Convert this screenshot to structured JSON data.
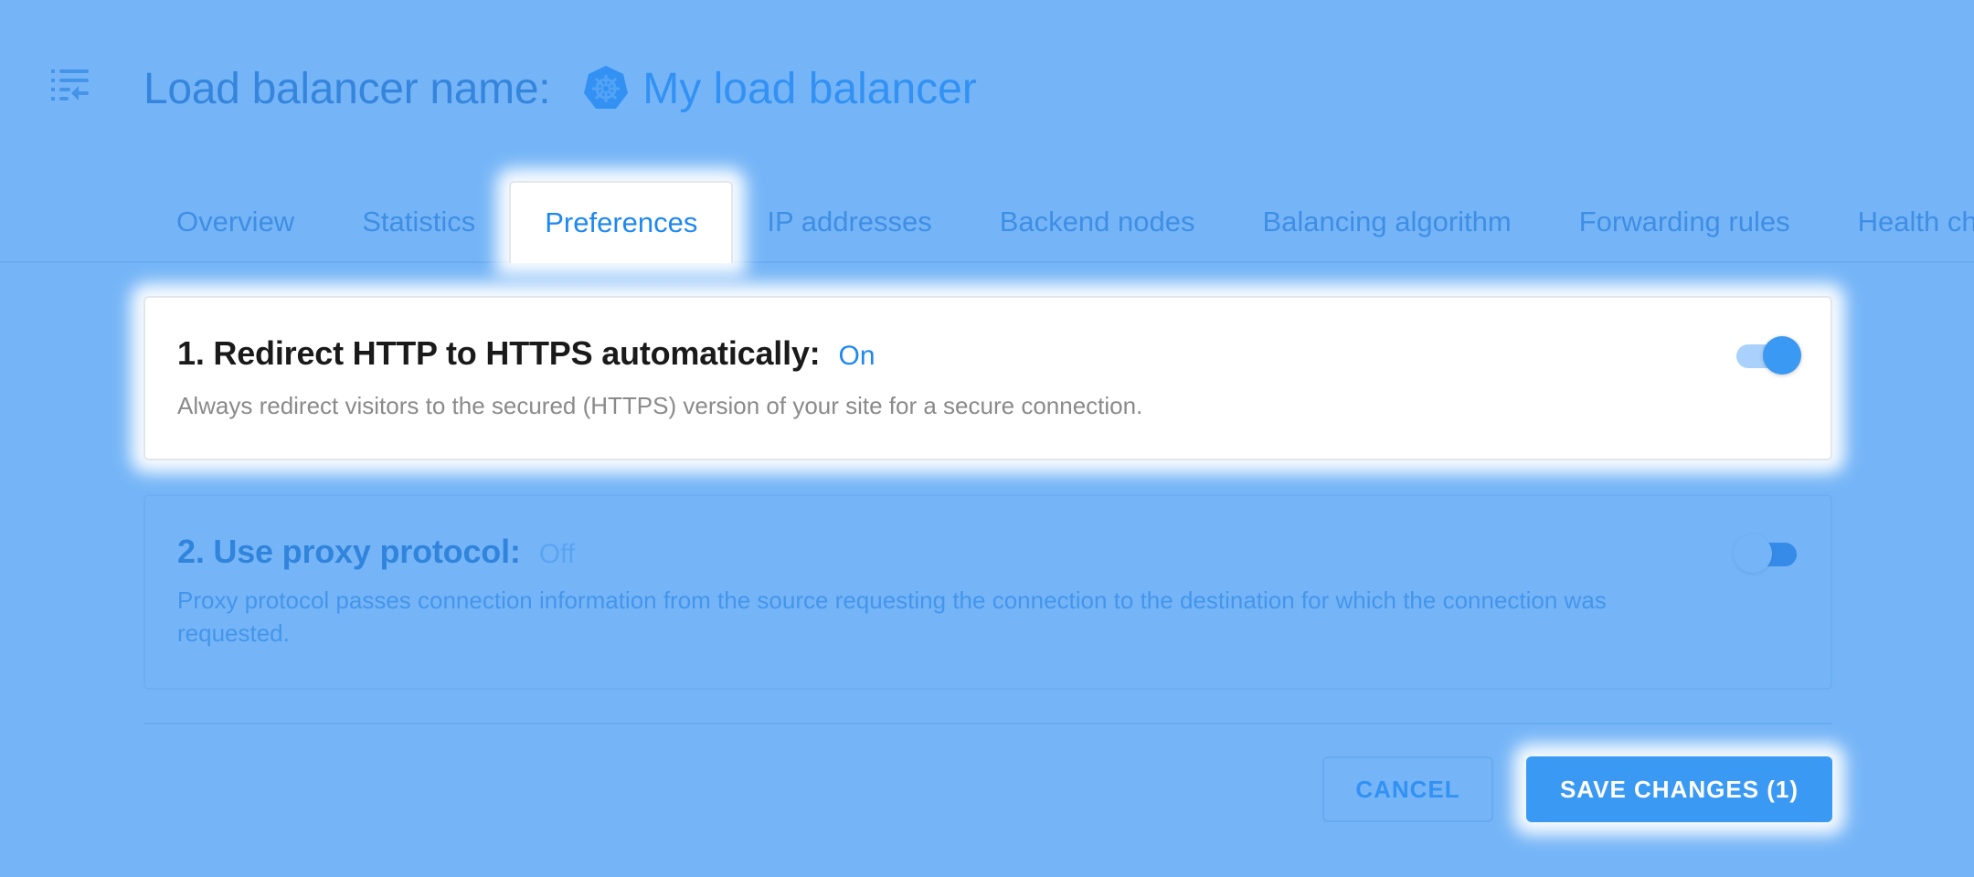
{
  "header": {
    "menu_icon": "collapse-menu-icon",
    "title_label": "Load balancer name:",
    "lb_icon": "kubernetes-helm-icon",
    "lb_name": "My load balancer"
  },
  "tabs": [
    {
      "label": "Overview",
      "active": false
    },
    {
      "label": "Statistics",
      "active": false
    },
    {
      "label": "Preferences",
      "active": true
    },
    {
      "label": "IP addresses",
      "active": false
    },
    {
      "label": "Backend nodes",
      "active": false
    },
    {
      "label": "Balancing algorithm",
      "active": false
    },
    {
      "label": "Forwarding rules",
      "active": false
    },
    {
      "label": "Health checks",
      "active": false
    }
  ],
  "settings": [
    {
      "title": "1. Redirect HTTP to HTTPS automatically:",
      "state_label": "On",
      "enabled": true,
      "description": "Always redirect visitors to the secured (HTTPS) version of your site for a secure connection."
    },
    {
      "title": "2. Use proxy protocol:",
      "state_label": "Off",
      "enabled": false,
      "description": "Proxy protocol passes connection information from the source requesting the connection to the destination for which the connection was requested."
    }
  ],
  "actions": {
    "cancel_label": "CANCEL",
    "save_label": "SAVE CHANGES (1)",
    "pending_changes": 1
  },
  "colors": {
    "accent": "#3a99f3",
    "overlay": "#72b6f7",
    "title_text": "#1a1a1a"
  }
}
